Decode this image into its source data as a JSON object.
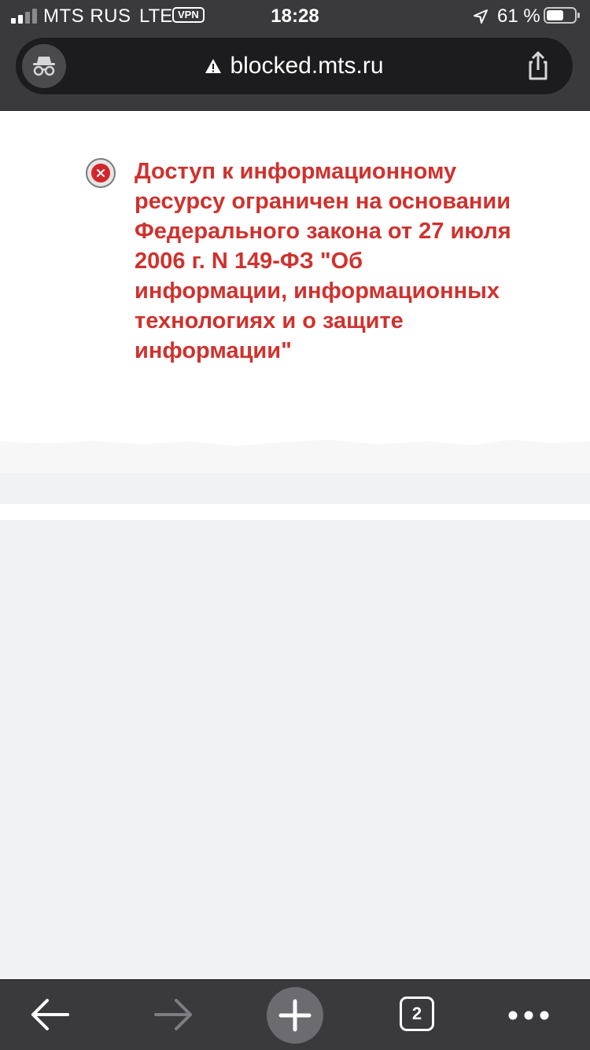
{
  "status_bar": {
    "carrier": "MTS RUS",
    "network": "LTE",
    "vpn_label": "VPN",
    "time": "18:28",
    "battery_percent": "61 %",
    "battery_level": 0.61,
    "signal_bars": 2,
    "signal_total": 4
  },
  "address_bar": {
    "domain": "blocked.mts.ru",
    "incognito_icon": "incognito-icon",
    "security_icon": "warning-triangle-icon",
    "share_icon": "share-icon"
  },
  "page": {
    "notice_text": "Доступ к информационному ресурсу ограничен на основании Федерального закона от 27 июля 2006 г. N 149-ФЗ \"Об информации, информационных технологиях и о защите информации\"",
    "notice_color": "#d0312d",
    "blocked_icon": "blocked-x-icon"
  },
  "toolbar": {
    "open_tabs_count": "2",
    "back_icon": "back-arrow-icon",
    "forward_icon": "forward-arrow-icon",
    "new_tab_icon": "plus-icon",
    "menu_icon": "more-dots-icon"
  }
}
